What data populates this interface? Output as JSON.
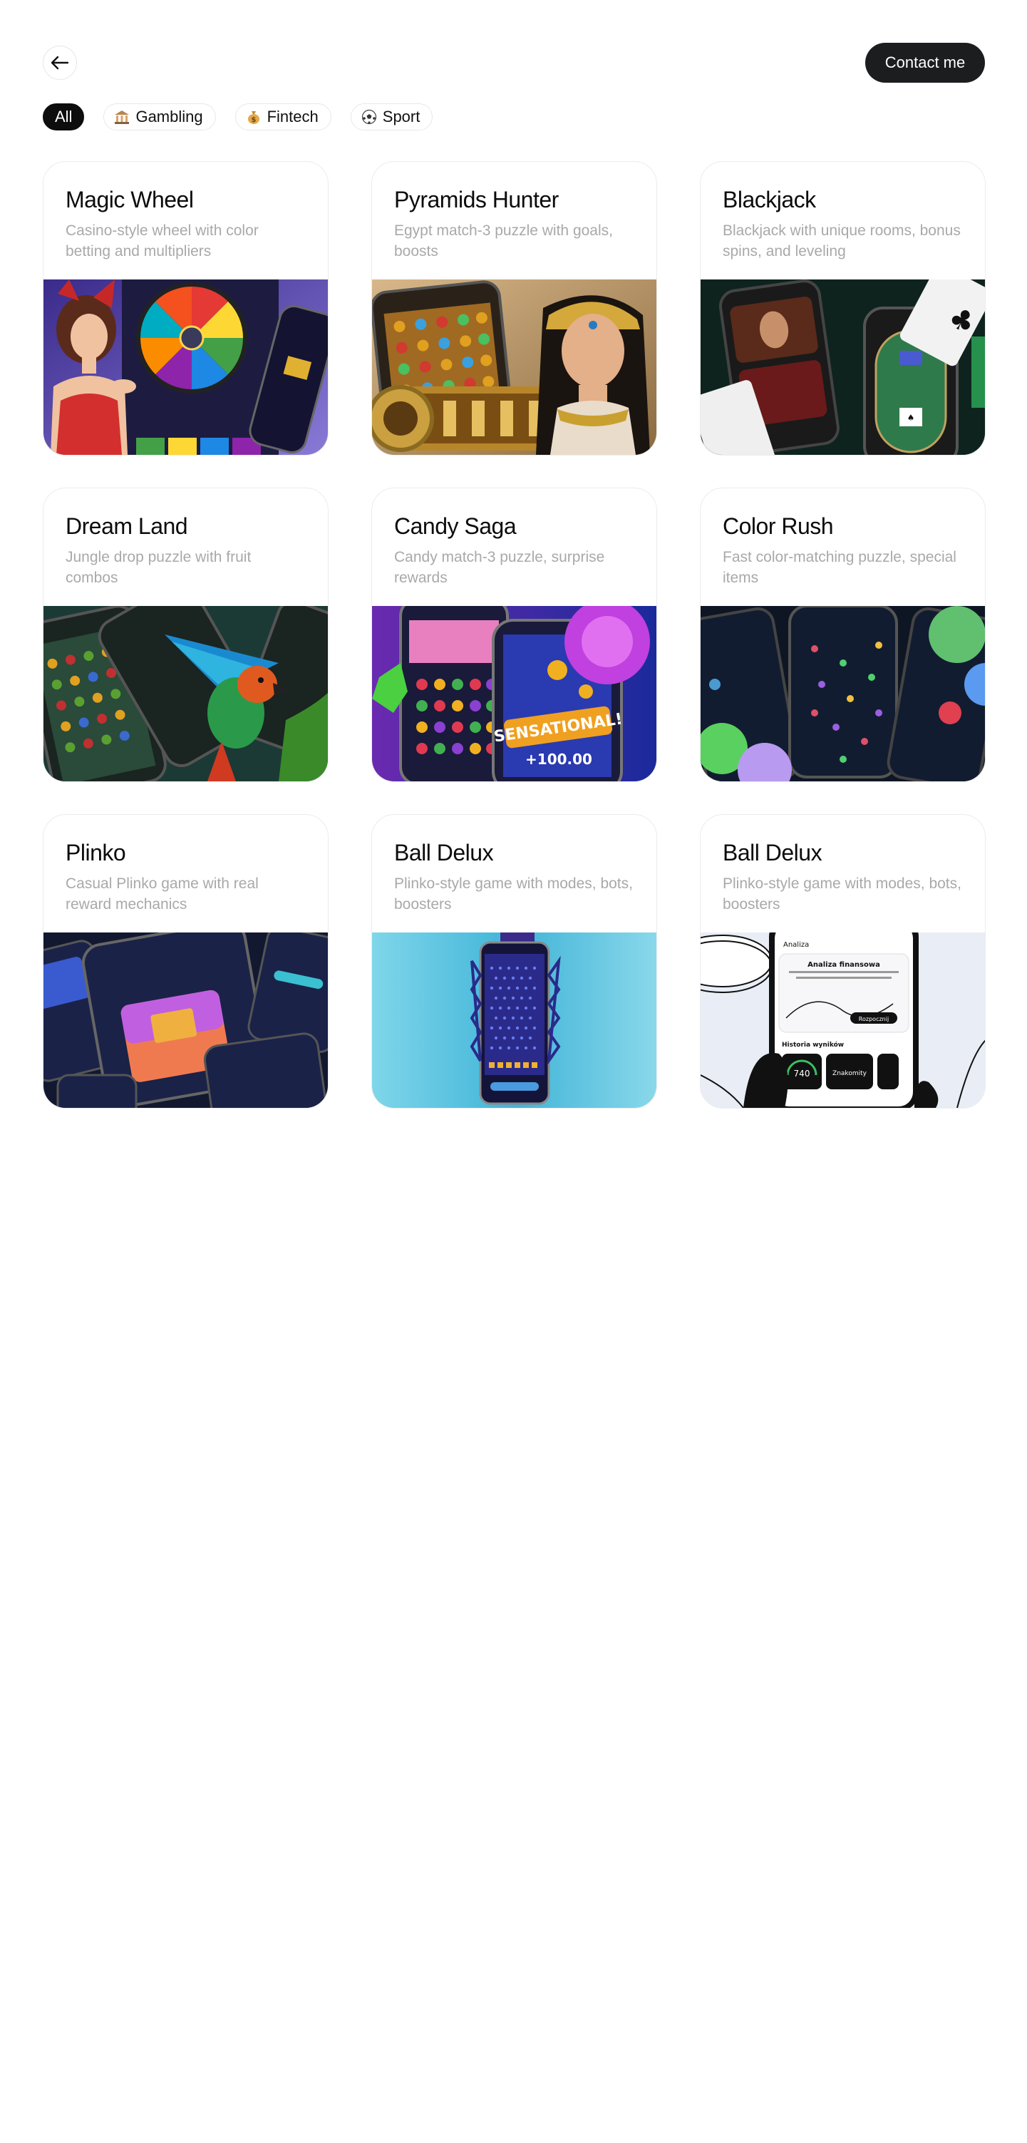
{
  "header": {
    "contact_label": "Contact me"
  },
  "filters": [
    {
      "label": "All",
      "icon": "none",
      "active": true
    },
    {
      "label": "Gambling",
      "icon": "bank-emoji-icon",
      "active": false
    },
    {
      "label": "Fintech",
      "icon": "money-bag-emoji-icon",
      "active": false
    },
    {
      "label": "Sport",
      "icon": "soccer-ball-emoji-icon",
      "active": false
    }
  ],
  "cards": [
    {
      "title": "Magic Wheel",
      "description": "Casino-style wheel with color betting and multipliers",
      "image": "magic-wheel-artwork"
    },
    {
      "title": "Pyramids Hunter",
      "description": "Egypt match-3 puzzle with goals, boosts",
      "image": "pyramids-hunter-artwork"
    },
    {
      "title": "Blackjack",
      "description": "Blackjack with unique rooms, bonus spins, and leveling",
      "image": "blackjack-artwork"
    },
    {
      "title": "Dream Land",
      "description": "Jungle drop puzzle with fruit combos",
      "image": "dream-land-artwork"
    },
    {
      "title": "Candy Saga",
      "description": "Candy match-3 puzzle, surprise rewards",
      "image": "candy-saga-artwork"
    },
    {
      "title": "Color Rush",
      "description": "Fast color-matching puzzle, special items",
      "image": "color-rush-artwork"
    },
    {
      "title": "Plinko",
      "description": "Casual Plinko game with real reward mechanics",
      "image": "plinko-artwork"
    },
    {
      "title": "Ball Delux",
      "description": "Plinko-style game with modes, bots, boosters",
      "image": "ball-delux-artwork"
    },
    {
      "title": "Ball Delux",
      "description": "Plinko-style game with modes, bots, boosters",
      "image": "ball-delux-fintech-artwork"
    }
  ],
  "artwork_text": {
    "candy_banner": "SENSATIONAL!",
    "candy_amount": "+100.00",
    "finance_header": "Analiza",
    "finance_title": "Analiza finansowa",
    "finance_button": "Rozpocznij",
    "finance_history": "Historia wyników",
    "finance_score": "740",
    "finance_status": "Znakomity"
  }
}
